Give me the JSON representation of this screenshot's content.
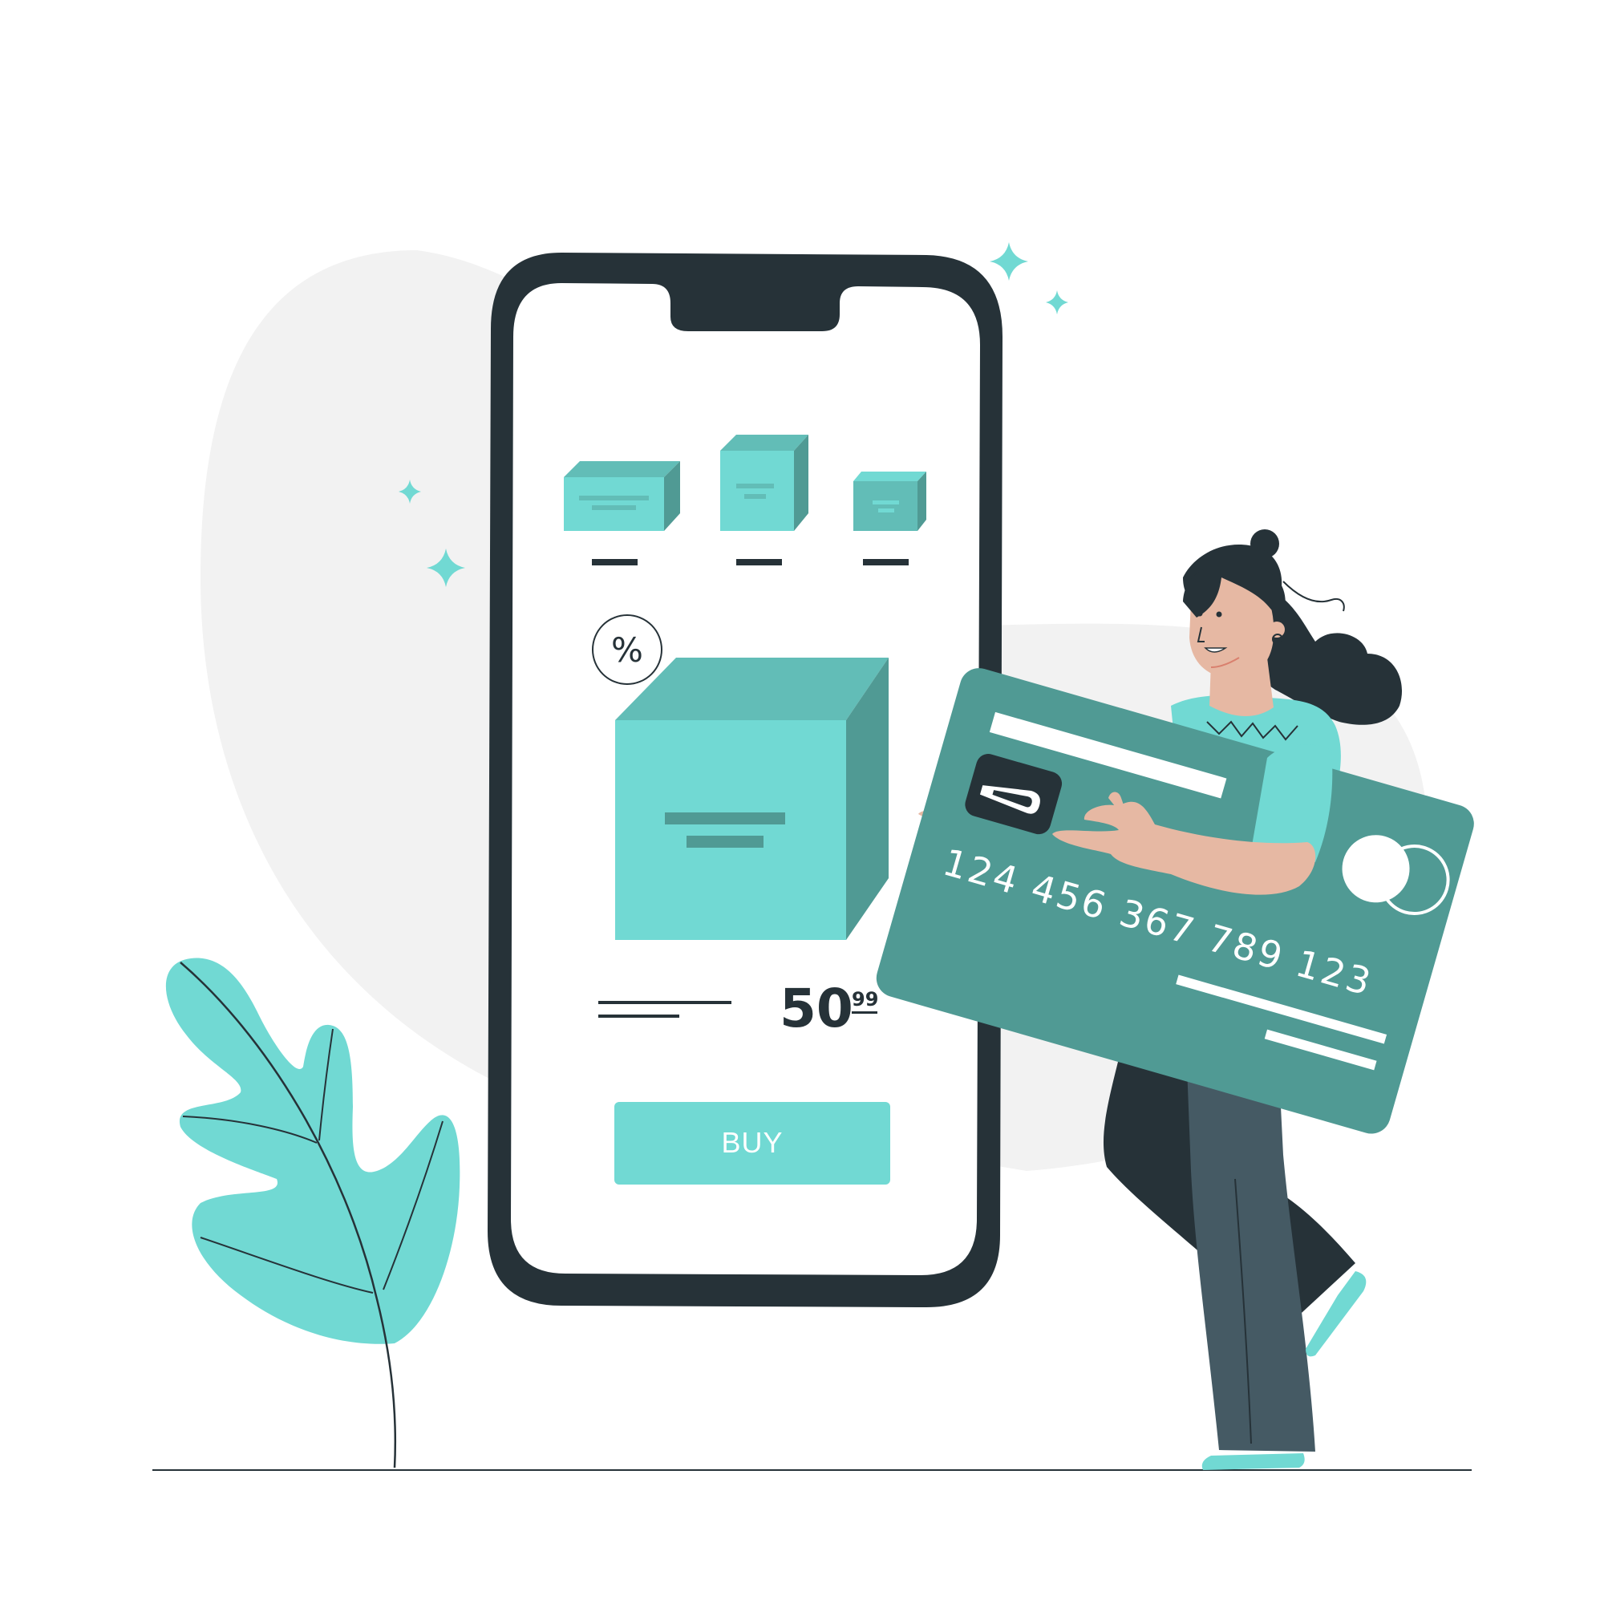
{
  "product": {
    "discount_symbol": "%",
    "price_whole": "50",
    "price_cents": "99",
    "buy_label": "BUY"
  },
  "credit_card": {
    "number": "124 456 367 789 123"
  },
  "colors": {
    "accent": "#71d9d3",
    "accent_mid": "#62bdb7",
    "accent_dark": "#509a94",
    "card": "#509a94",
    "dark": "#263238",
    "pants": "#455a64",
    "skin": "#e6b8a3",
    "blob": "#f2f2f2"
  },
  "icons": [
    "sparkle-icon",
    "leaf-plant-icon",
    "product-box-icon",
    "card-chip-icon",
    "percent-badge-icon"
  ]
}
